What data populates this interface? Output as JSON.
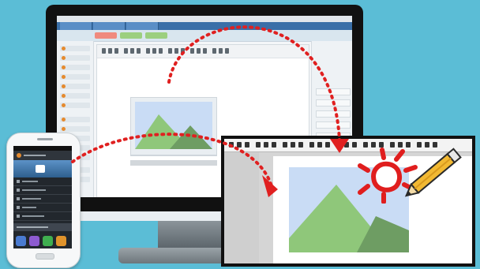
{
  "scene": {
    "background_color": "#5bbdd6",
    "devices": {
      "monitor": {
        "icon": "desktop-monitor-icon",
        "screen": "web-editor-with-image"
      },
      "phone": {
        "icon": "smartphone-icon",
        "screen": "mobile-menu-with-photo"
      },
      "zoom_panel": {
        "icon": "image-editor-icon"
      }
    },
    "image_icon": {
      "icon": "landscape-photo-icon",
      "sky_color": "#c9dcf5",
      "mountain_color": "#8fc77a",
      "mountain_shadow": "#6e9d63"
    },
    "arrows": {
      "color": "#e02020",
      "style": "dotted",
      "count": 2
    },
    "pencil": {
      "icon": "pencil-icon",
      "color": "#f2b933"
    },
    "sun_doodle": {
      "icon": "sun-doodle-icon",
      "color": "#e01e1e"
    }
  }
}
